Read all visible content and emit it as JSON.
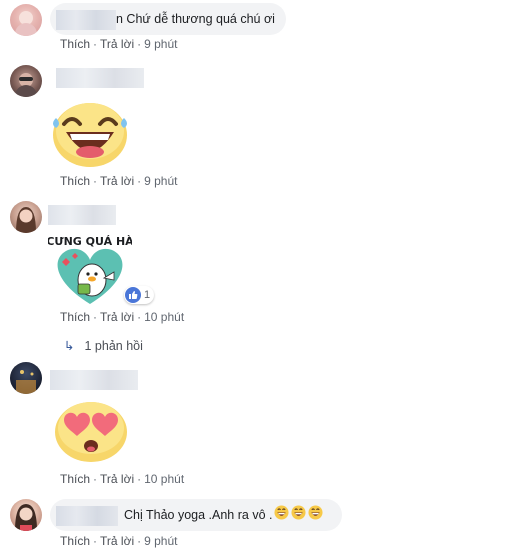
{
  "comments": [
    {
      "text": "n Chứ dễ thương quá chú ơi",
      "actions": {
        "like": "Thích",
        "reply": "Trả lời",
        "time": "9 phút"
      }
    },
    {
      "sticker": "laughing-face-sticker",
      "actions": {
        "like": "Thích",
        "reply": "Trả lời",
        "time": "9 phút"
      }
    },
    {
      "sticker": "cung-qua-ha-duck-sticker",
      "sticker_text": "CƯNG QUÁ HÀ",
      "reaction_count": "1",
      "actions": {
        "like": "Thích",
        "reply": "Trả lời",
        "time": "10 phút"
      },
      "replies_label": "1 phản hồi"
    },
    {
      "sticker": "heart-eyes-face-sticker",
      "actions": {
        "like": "Thích",
        "reply": "Trả lời",
        "time": "10 phút"
      }
    },
    {
      "text": "Chị Thảo yoga .Anh ra vô .",
      "emoji": [
        "grinning-emoji",
        "grinning-emoji",
        "grinning-emoji"
      ],
      "actions": {
        "like": "Thích",
        "reply": "Trả lời",
        "time": "9 phút"
      }
    }
  ],
  "separator": "·",
  "colors": {
    "bubble": "#f2f3f5",
    "link": "#4b4f56",
    "meta": "#616770",
    "like_blue": "#4a76d8",
    "reply_arrow": "#365899"
  }
}
